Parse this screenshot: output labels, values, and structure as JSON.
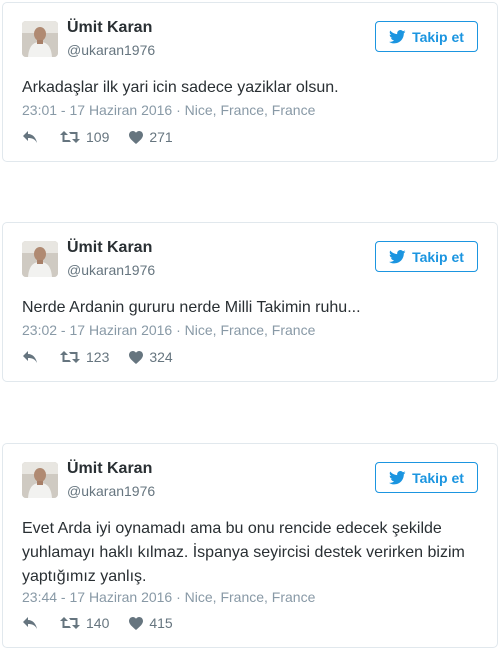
{
  "colors": {
    "accent": "#1b95e0",
    "text": "#292f33",
    "muted": "#8899a6",
    "border": "#e1e8ed"
  },
  "tweets": [
    {
      "author_name": "Ümit Karan",
      "author_handle": "@ukaran1976",
      "follow_label": "Takip et",
      "text": "Arkadaşlar ilk yari icin sadece yaziklar olsun.",
      "meta": "23:01 - 17 Haziran 2016 · Nice, France, France",
      "retweets": "109",
      "likes": "271"
    },
    {
      "author_name": "Ümit Karan",
      "author_handle": "@ukaran1976",
      "follow_label": "Takip et",
      "text": "Nerde Ardanin gururu nerde Milli Takimin ruhu...",
      "meta": "23:02 - 17 Haziran 2016 · Nice, France, France",
      "retweets": "123",
      "likes": "324"
    },
    {
      "author_name": "Ümit Karan",
      "author_handle": "@ukaran1976",
      "follow_label": "Takip et",
      "text": "Evet Arda iyi oynamadı ama bu onu rencide edecek şekilde yuhlamayı haklı kılmaz. İspanya seyircisi destek verirken bizim yaptığımız yanlış.",
      "meta": "23:44 - 17 Haziran 2016 · Nice, France, France",
      "retweets": "140",
      "likes": "415"
    }
  ],
  "icons": {
    "reply": "reply-icon",
    "retweet": "retweet-icon",
    "like": "heart-icon",
    "bird": "twitter-bird-icon"
  }
}
